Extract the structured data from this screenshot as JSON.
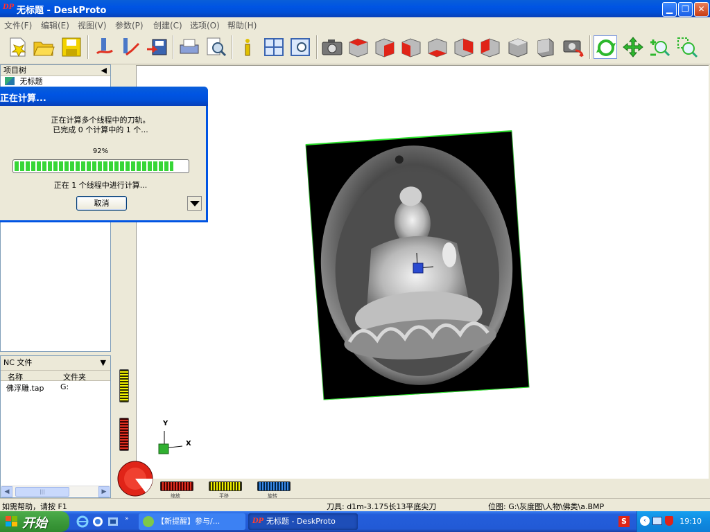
{
  "window": {
    "title": "无标题 - DeskProto",
    "app_icon": "DP",
    "minimize_icon": "minimize-icon",
    "restore_icon": "restore-icon",
    "close_icon": "close-icon"
  },
  "menu": [
    "文件(F)",
    "编辑(E)",
    "视图(V)",
    "参数(P)",
    "创建(C)",
    "选项(O)",
    "帮助(H)"
  ],
  "toolbar_icons": [
    "new-file-icon",
    "open-folder-icon",
    "save-icon",
    "toolpath-icon",
    "toolpath-2-icon",
    "export-icon",
    "print-icon",
    "print-preview-icon",
    "info-icon",
    "layout-icon",
    "zoom-window-icon",
    "camera-icon",
    "view-red-1-icon",
    "view-red-2-icon",
    "view-red-3-icon",
    "view-red-4-icon",
    "view-red-5-icon",
    "view-red-6-icon",
    "view-gray-1-icon",
    "view-gray-2-icon",
    "camera-reset-icon",
    "rotate-icon",
    "pan-icon",
    "zoom-in-icon",
    "zoom-fit-icon"
  ],
  "project_tree": {
    "header": "项目树",
    "items": [
      "无标题"
    ]
  },
  "dialog": {
    "title": "正在计算...",
    "line1": "正在计算多个线程中的刀轨。",
    "line2": "已完成 0 个计算中的 1 个...",
    "percent_text": "92%",
    "progress": 0.92,
    "status": "正在 1 个线程中进行计算...",
    "cancel_label": "取消"
  },
  "nc_panel": {
    "header": "NC 文件",
    "columns": [
      "名称",
      "文件夹"
    ],
    "rows": [
      [
        "佛浮雕.tap",
        "G:"
      ]
    ]
  },
  "viewport": {
    "axis_y": "Y",
    "axis_x": "X"
  },
  "dials": {
    "labels": [
      "缩放",
      "平移",
      "旋转"
    ]
  },
  "statusbar": {
    "help": "如需帮助，请按 F1",
    "tool": "刀具: d1m-3.175长13平底尖刀",
    "position": "位图: G:\\灰度图\\人物\\佛类\\a.BMP"
  },
  "taskbar": {
    "start_label": "开始",
    "tasks": [
      "【新提醒】参与/...",
      "无标题 - DeskProto"
    ],
    "clock": "19:10"
  },
  "colors": {
    "xp_blue": "#0054e3",
    "progress_green": "#37d637",
    "start_green": "#3c9a3b"
  }
}
